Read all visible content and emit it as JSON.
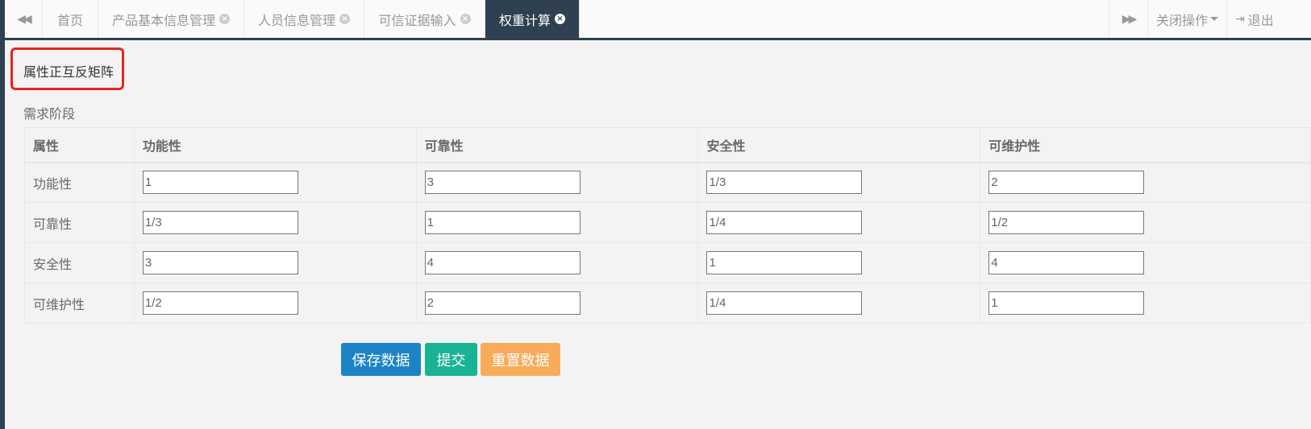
{
  "tabs": {
    "prev_icon": "double-left-arrow-icon",
    "items": [
      {
        "label": "首页",
        "closable": false,
        "active": false
      },
      {
        "label": "产品基本信息管理",
        "closable": true,
        "active": false
      },
      {
        "label": "人员信息管理",
        "closable": true,
        "active": false
      },
      {
        "label": "可信证据输入",
        "closable": true,
        "active": false
      },
      {
        "label": "权重计算",
        "closable": true,
        "active": true
      }
    ],
    "next_icon": "double-right-arrow-icon",
    "close_ops_label": "关闭操作",
    "logout_label": "退出"
  },
  "section": {
    "title": "属性正互反矩阵",
    "stage": "需求阶段"
  },
  "matrix": {
    "headers": [
      "属性",
      "功能性",
      "可靠性",
      "安全性",
      "可维护性"
    ],
    "rows": [
      {
        "label": "功能性",
        "values": [
          "1",
          "3",
          "1/3",
          "2"
        ]
      },
      {
        "label": "可靠性",
        "values": [
          "1/3",
          "1",
          "1/4",
          "1/2"
        ]
      },
      {
        "label": "安全性",
        "values": [
          "3",
          "4",
          "1",
          "4"
        ]
      },
      {
        "label": "可维护性",
        "values": [
          "1/2",
          "2",
          "1/4",
          "1"
        ]
      }
    ]
  },
  "buttons": {
    "save": "保存数据",
    "submit": "提交",
    "reset": "重置数据"
  },
  "colors": {
    "sidebar": "#2f4050",
    "primary": "#1c84c6",
    "success": "#1ab394",
    "warning": "#f8ac59",
    "highlight": "#e3261e"
  }
}
